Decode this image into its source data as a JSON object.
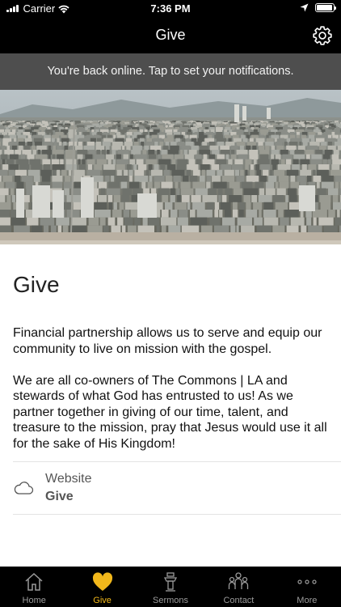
{
  "status_bar": {
    "carrier": "Carrier",
    "time": "7:36 PM",
    "battery_level": 0.95
  },
  "nav": {
    "title": "Give",
    "settings_icon": "gear-icon"
  },
  "banner": {
    "text": "You're back online. Tap to set your notifications."
  },
  "page": {
    "title": "Give",
    "paragraphs": [
      "Financial partnership allows us to serve and equip our community to live on mission with the gospel.",
      "We are all co-owners of The Commons | LA and stewards of what God has entrusted to us! As we partner together in giving of our time, talent, and treasure to the mission, pray that Jesus would use it all for the sake of His Kingdom!"
    ],
    "link": {
      "icon": "cloud-icon",
      "label": "Website",
      "value": "Give"
    }
  },
  "tabs": [
    {
      "label": "Home",
      "icon": "home-icon",
      "active": false
    },
    {
      "label": "Give",
      "icon": "heart-icon",
      "active": true
    },
    {
      "label": "Sermons",
      "icon": "podium-icon",
      "active": false
    },
    {
      "label": "Contact",
      "icon": "people-icon",
      "active": false
    },
    {
      "label": "More",
      "icon": "more-icon",
      "active": false
    }
  ],
  "colors": {
    "accent": "#f2b81b",
    "bar_background": "#000000",
    "banner_background": "#4e4e4e"
  }
}
